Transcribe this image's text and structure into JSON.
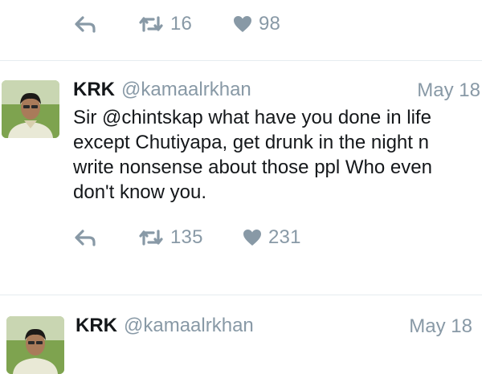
{
  "top_actions": {
    "reply_icon": "reply-icon",
    "retweet_count": "16",
    "like_count": "98"
  },
  "tweets": [
    {
      "name": "KRK",
      "handle": "@kamaalrkhan",
      "date": "May 18",
      "text_lines": [
        "Sir @chintskap what have you done in life",
        "except Chutiyapa, get drunk in the night n",
        "write nonsense about those ppl Who even",
        "don't know you."
      ],
      "retweet_count": "135",
      "like_count": "231"
    },
    {
      "name": "KRK",
      "handle": "@kamaalrkhan",
      "date": "May 18"
    }
  ],
  "colors": {
    "icon_gray": "#8899a6",
    "divider": "#e6ecf0",
    "text": "#14171a"
  }
}
